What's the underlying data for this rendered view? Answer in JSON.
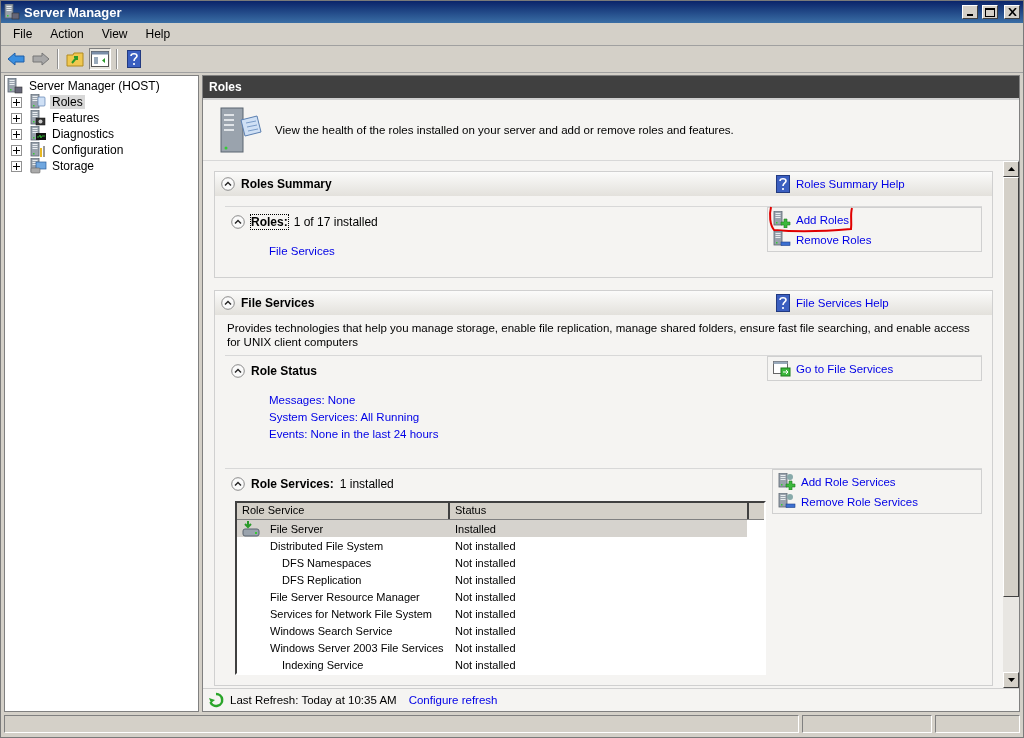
{
  "window": {
    "title": "Server Manager"
  },
  "menu": [
    "File",
    "Action",
    "View",
    "Help"
  ],
  "tree": {
    "label": "Server Manager (HOST)",
    "children": [
      {
        "label": "Roles",
        "kind": "roles",
        "selected": true,
        "expanded": false
      },
      {
        "label": "Features",
        "kind": "features",
        "selected": false,
        "expanded": false
      },
      {
        "label": "Diagnostics",
        "kind": "diagnostics",
        "selected": false,
        "expanded": false
      },
      {
        "label": "Configuration",
        "kind": "configuration",
        "selected": false,
        "expanded": false
      },
      {
        "label": "Storage",
        "kind": "storage",
        "selected": false,
        "expanded": false
      }
    ]
  },
  "pane": {
    "title": "Roles",
    "intro": "View the health of the roles installed on your server and add or remove roles and features."
  },
  "roles_summary": {
    "title": "Roles Summary",
    "expanded": true,
    "help": "Roles Summary Help",
    "roles": {
      "label": "Roles:",
      "count": "1 of 17 installed",
      "expanded": true,
      "links": [
        "File Services"
      ]
    },
    "actions": [
      {
        "label": "Add Roles",
        "kind": "add",
        "circled": true
      },
      {
        "label": "Remove Roles",
        "kind": "remove",
        "circled": false
      }
    ]
  },
  "file_services": {
    "title": "File Services",
    "expanded": true,
    "help": "File Services Help",
    "description": "Provides technologies that help you manage storage, enable file replication, manage shared folders, ensure fast file searching, and enable access for UNIX client computers",
    "role_status": {
      "title": "Role Status",
      "expanded": true,
      "links": [
        "Messages: None",
        "System Services: All Running",
        "Events: None in the last 24 hours"
      ],
      "actions": [
        {
          "label": "Go to File Services",
          "kind": "go",
          "circled": false
        }
      ]
    },
    "role_services": {
      "title": "Role Services:",
      "count": "1 installed",
      "expanded": true,
      "columns": [
        "Role Service",
        "Status"
      ],
      "rows": [
        {
          "name": "File Server",
          "status": "Installed",
          "installed": true,
          "selected": true
        },
        {
          "name": "Distributed File System",
          "status": "Not installed",
          "installed": false,
          "selected": false,
          "children": [
            {
              "name": "DFS Namespaces",
              "status": "Not installed",
              "installed": false,
              "selected": false
            },
            {
              "name": "DFS Replication",
              "status": "Not installed",
              "installed": false,
              "selected": false
            }
          ]
        },
        {
          "name": "File Server Resource Manager",
          "status": "Not installed",
          "installed": false,
          "selected": false
        },
        {
          "name": "Services for Network File System",
          "status": "Not installed",
          "installed": false,
          "selected": false
        },
        {
          "name": "Windows Search Service",
          "status": "Not installed",
          "installed": false,
          "selected": false
        },
        {
          "name": "Windows Server 2003 File Services",
          "status": "Not installed",
          "installed": false,
          "selected": false,
          "children": [
            {
              "name": "Indexing Service",
              "status": "Not installed",
              "installed": false,
              "selected": false
            }
          ]
        }
      ],
      "actions": [
        {
          "label": "Add Role Services",
          "kind": "add-gear",
          "circled": false
        },
        {
          "label": "Remove Role Services",
          "kind": "remove-gear",
          "circled": false
        }
      ]
    }
  },
  "footer": {
    "last_refresh": "Last Refresh: Today at 10:35 AM",
    "configure": "Configure refresh"
  }
}
